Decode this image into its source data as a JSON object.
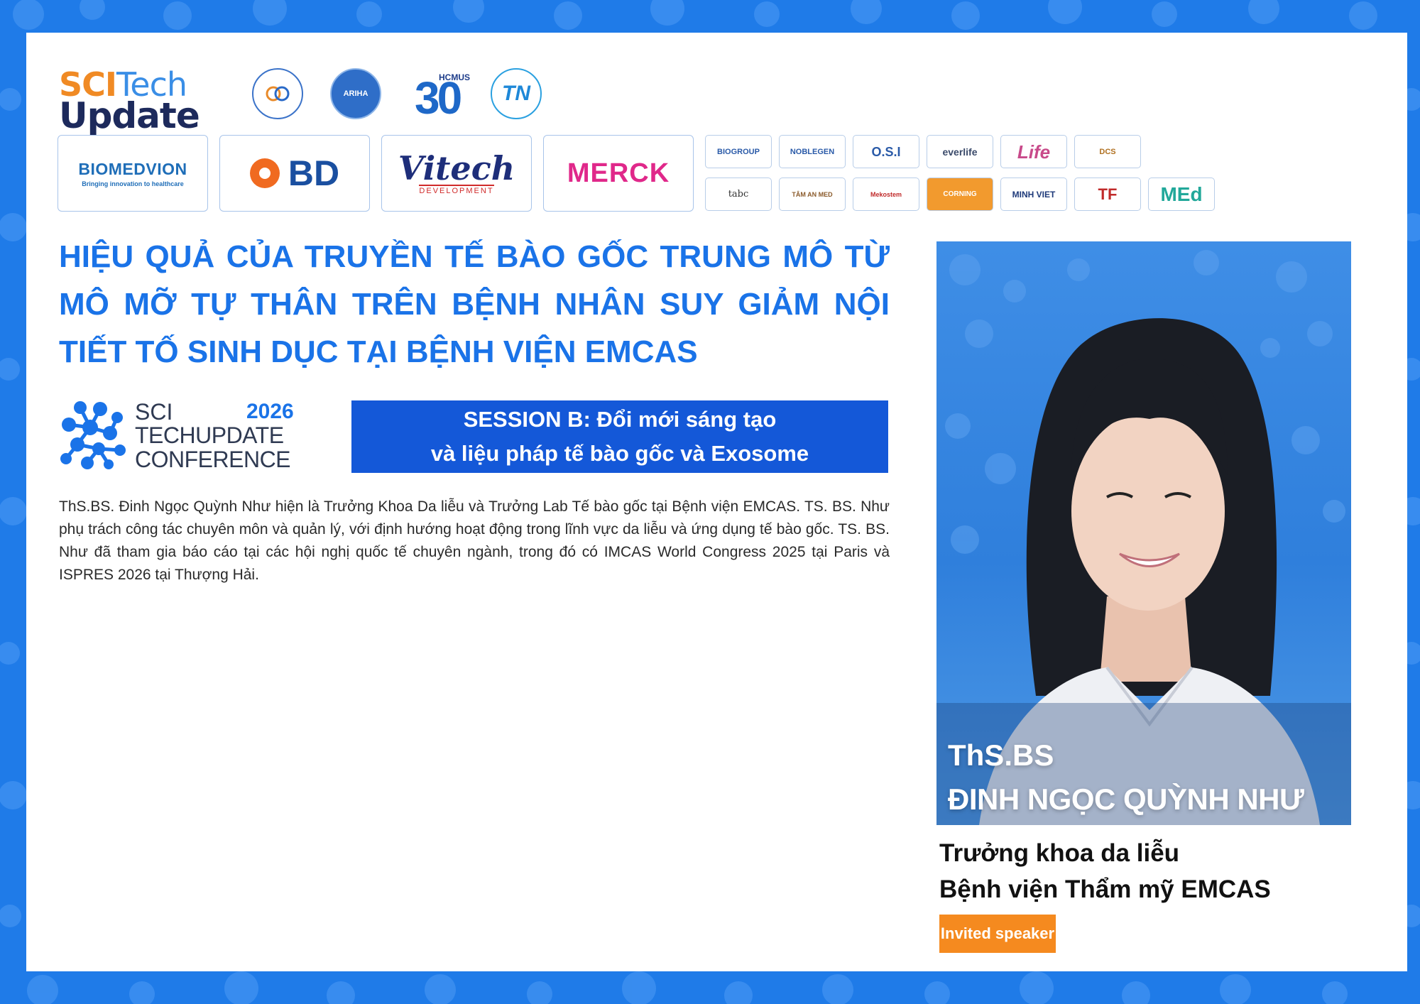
{
  "colors": {
    "frame": "#1f7be8",
    "title": "#1a73e8",
    "session_bg": "#1458d8",
    "badge": "#f58a1f"
  },
  "brand": {
    "part1": "SCI",
    "part2": "Tech",
    "part3": "Update"
  },
  "org_logos": {
    "hcmus_text": "HCMUS",
    "hcmus_number": "30",
    "ariha": "ARIHA",
    "tn": "TN"
  },
  "sponsors_main": {
    "biomedvion": {
      "name": "BIOMEDVION",
      "tagline": "Bringing innovation to healthcare"
    },
    "bd": "BD",
    "vitech": {
      "name": "Vitech",
      "tagline": "DEVELOPMENT"
    },
    "merck": "MERCK"
  },
  "sponsors_small": [
    "BIOGROUP",
    "NOBLEGEN",
    "O.S.I",
    "everlife",
    "Life",
    "DCS",
    "tabc",
    "TÂM AN MED",
    "Mekostem",
    "CORNING",
    "MINH VIET",
    "TF",
    "MEd"
  ],
  "title": "HIỆU QUẢ CỦA TRUYỀN TẾ BÀO GỐC TRUNG MÔ TỪ MÔ MỠ TỰ THÂN TRÊN BỆNH NHÂN SUY GIẢM NỘI TIẾT TỐ SINH DỤC TẠI BỆNH VIỆN EMCAS",
  "conference": {
    "line1": "SCI",
    "year": "2026",
    "line2": "TECHUPDATE",
    "line3": "CONFERENCE"
  },
  "session": {
    "line1": "SESSION B: Đổi mới sáng tạo",
    "line2": "và liệu pháp tế bào gốc và Exosome"
  },
  "bio": "ThS.BS. Đinh Ngọc Quỳnh Như hiện là Trưởng Khoa Da liễu và Trưởng Lab Tế bào gốc tại Bệnh viện EMCAS. TS. BS. Như phụ trách công tác chuyên môn và quản lý, với định hướng hoạt động trong lĩnh vực da liễu và ứng dụng tế bào gốc. TS. BS. Như đã tham gia báo cáo tại các hội nghị quốc tế chuyên ngành, trong đó có IMCAS World Congress 2025 tại Paris và ISPRES 2026 tại Thượng Hải.",
  "speaker": {
    "degree": "ThS.BS",
    "name": "ĐINH NGỌC QUỲNH NHƯ",
    "role_line1": "Trưởng khoa da liễu",
    "role_line2": "Bệnh viện Thẩm mỹ EMCAS",
    "badge": "Invited speaker"
  }
}
